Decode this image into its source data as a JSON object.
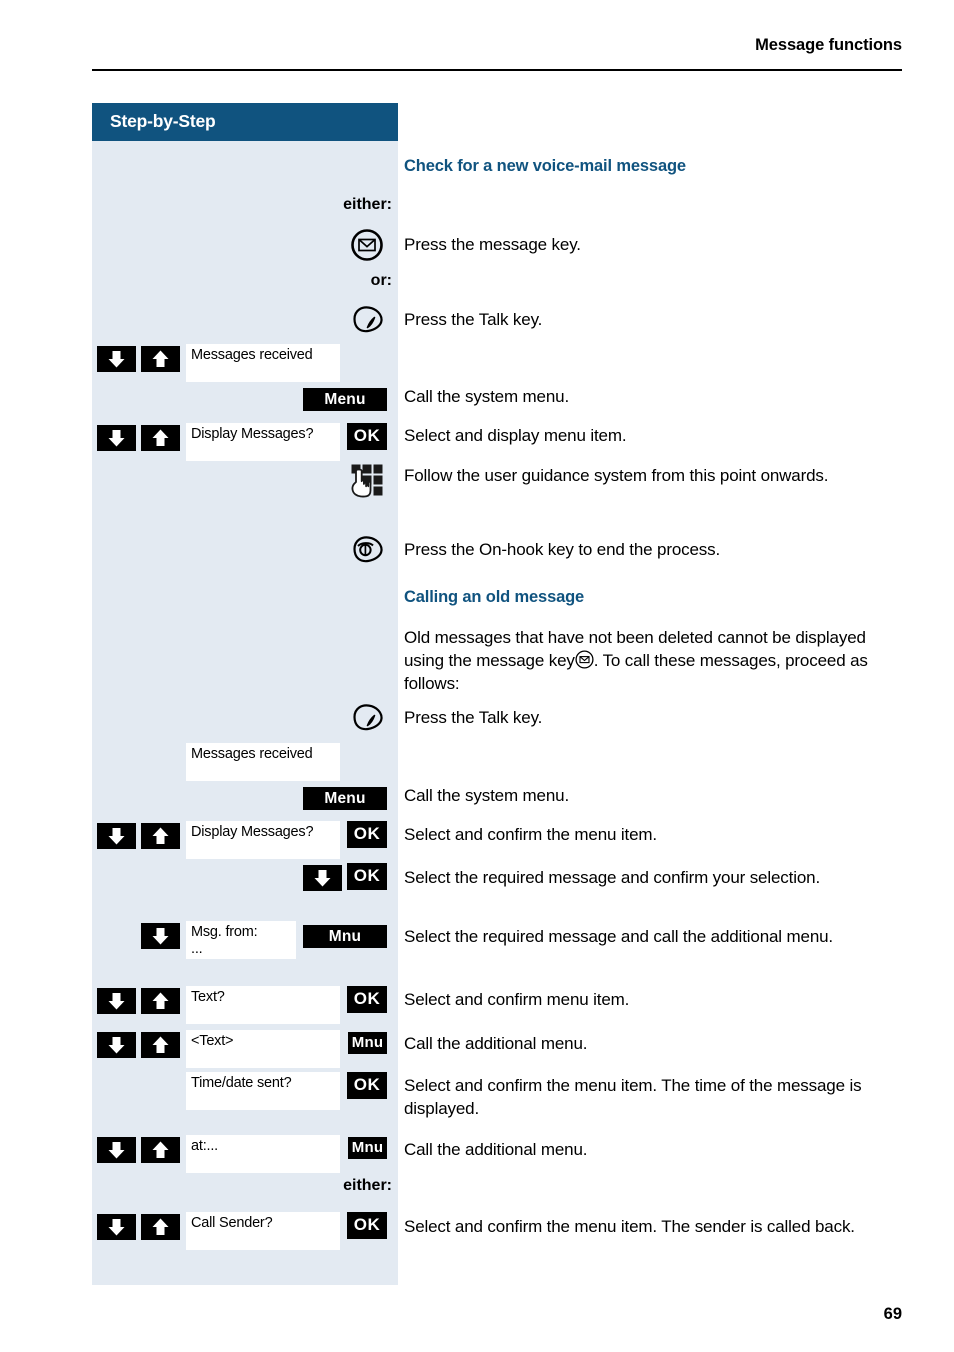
{
  "header": {
    "running_title": "Message functions"
  },
  "sidebar": {
    "title": "Step-by-Step"
  },
  "footer": {
    "page_number": "69"
  },
  "colors": {
    "heading_blue": "#10537f",
    "panel_bg": "#e3eaf2",
    "key_black": "#000000",
    "display_white": "#ffffff"
  },
  "sections": [
    {
      "heading": "Check for a new voice-mail message",
      "steps": [
        {
          "label": "either:",
          "text": ""
        },
        {
          "icon": "message-key-icon",
          "text": "Press the message key."
        },
        {
          "label": "or:",
          "text": ""
        },
        {
          "icon": "talk-key-icon",
          "text": "Press the Talk key."
        },
        {
          "display": "Messages received",
          "keys": [
            "down-arrow-key",
            "up-arrow-key"
          ],
          "text": ""
        },
        {
          "softkey": "Menu",
          "text": "Call the system menu."
        },
        {
          "display": "Display Messages?",
          "keys": [
            "down-arrow-key",
            "up-arrow-key"
          ],
          "softkey": "OK",
          "text": "Select and display menu item."
        },
        {
          "icon": "keypad-icon",
          "text": "Follow the user guidance system from this point onwards."
        },
        {
          "icon": "on-hook-key-icon",
          "text": "Press the On-hook key to end the process."
        }
      ]
    },
    {
      "heading": "Calling an old message",
      "intro_part1": "Old messages that have not been deleted cannot be displayed using the message key",
      "intro_part2": ". To call these messages, proceed as follows:",
      "steps": [
        {
          "icon": "talk-key-icon",
          "text": "Press the Talk key."
        },
        {
          "display": "Messages received",
          "text": ""
        },
        {
          "softkey": "Menu",
          "text": "Call the system menu."
        },
        {
          "display": "Display Messages?",
          "keys": [
            "down-arrow-key",
            "up-arrow-key"
          ],
          "softkey": "OK",
          "text": "Select and confirm the menu item."
        },
        {
          "keys": [
            "down-arrow-key"
          ],
          "softkey": "OK",
          "text": "Select the required message and confirm your selection."
        },
        {
          "display_line1": "Msg. from:",
          "display_line2": "...",
          "keys": [
            "down-arrow-key"
          ],
          "softkey": "Mnu",
          "text": "Select the required message and call the additional menu."
        },
        {
          "display": "Text?",
          "keys": [
            "down-arrow-key",
            "up-arrow-key"
          ],
          "softkey": "OK",
          "text": "Select and confirm menu item."
        },
        {
          "display": "<Text>",
          "keys": [
            "down-arrow-key",
            "up-arrow-key"
          ],
          "softkey": "Mnu",
          "text": "Call the additional menu."
        },
        {
          "display": "Time/date sent?",
          "softkey": "OK",
          "text": "Select and confirm the menu item. The time of the message is displayed."
        },
        {
          "display": "at:...",
          "keys": [
            "down-arrow-key",
            "up-arrow-key"
          ],
          "softkey": "Mnu",
          "text": "Call the additional menu."
        },
        {
          "label": "either:",
          "text": ""
        },
        {
          "display": "Call Sender?",
          "keys": [
            "down-arrow-key",
            "up-arrow-key"
          ],
          "softkey": "OK",
          "text": "Select and confirm the menu item. The sender is called back."
        }
      ]
    }
  ],
  "labels": {
    "either": "either:",
    "or": "or:",
    "menu": "Menu",
    "mnu": "Mnu",
    "ok": "OK"
  },
  "displays": {
    "messages_received_1": "Messages received",
    "display_messages_1": "Display Messages?",
    "messages_received_2": "Messages received",
    "display_messages_2": "Display Messages?",
    "msg_from_l1": "Msg. from:",
    "msg_from_l2": "...",
    "text_q": "Text?",
    "text_angle": "<Text>",
    "time_date_sent": "Time/date sent?",
    "at_dots": "at:...",
    "call_sender": "Call Sender?"
  },
  "body": {
    "h2_a": "Check for a new voice-mail message",
    "h2_b": "Calling an old message",
    "p_press_message_key": "Press the message key.",
    "p_press_talk_key_1": "Press the Talk key.",
    "p_call_system_menu_1": "Call the system menu.",
    "p_select_display_item": "Select and display menu item.",
    "p_follow_guidance": "Follow the user guidance system from this point onwards.",
    "p_press_onhook": "Press the On-hook key to end the process.",
    "p_old_1": "Old messages that have not been deleted cannot be displayed using the message key",
    "p_old_2": ". To call these messages, proceed as follows:",
    "p_press_talk_key_2": "Press the Talk key.",
    "p_call_system_menu_2": "Call the system menu.",
    "p_select_confirm_item_1": "Select and confirm the menu item.",
    "p_select_required_confirm": "Select the required message and confirm your selection.",
    "p_select_required_addmenu": "Select the required message and call the additional menu.",
    "p_select_confirm_item_2": "Select and confirm menu item.",
    "p_call_add_menu_1": "Call the additional menu.",
    "p_select_confirm_time": "Select and confirm the menu item. The time of the message is displayed.",
    "p_call_add_menu_2": "Call the additional menu.",
    "p_select_confirm_sender": "Select and confirm the menu item. The sender is called back."
  }
}
